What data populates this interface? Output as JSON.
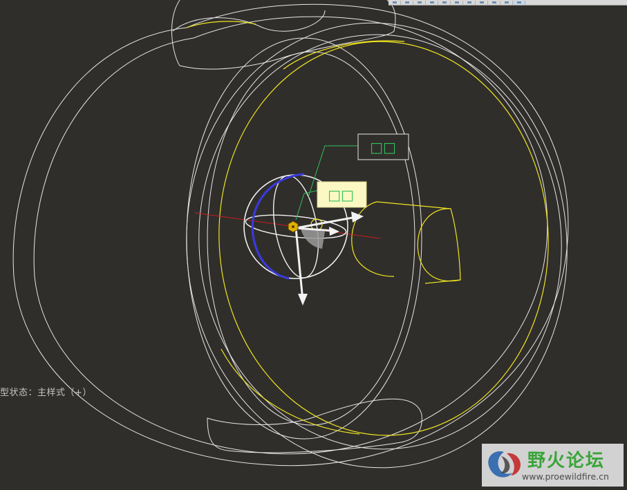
{
  "toolbar": {
    "buttons": [
      {
        "name": "view-orient-icon"
      },
      {
        "name": "arrow-icon"
      },
      {
        "name": "arrow-icon"
      },
      {
        "name": "view-cube-icon"
      },
      {
        "name": "refit-icon"
      },
      {
        "name": "zoom-icon"
      },
      {
        "name": "display-style-icon"
      },
      {
        "name": "saved-views-icon"
      },
      {
        "name": "datum-display-icon"
      },
      {
        "name": "spin-center-icon"
      },
      {
        "name": "settings-icon"
      }
    ]
  },
  "viewport": {
    "dragger_label": "□□",
    "offset_label": "□□",
    "status_text": "型状态：主样式（+）"
  },
  "watermark": {
    "title": "野火论坛",
    "url": "www.proewildfire.cn"
  },
  "colors": {
    "background": "#302e2b",
    "wireframe": "#e8e8e8",
    "highlight": "#f0e620",
    "dragger_blue": "#3a3ae0",
    "axis_red": "#c81e1e",
    "leader_green": "#2fc25b",
    "label_fill": "#fbf8c4"
  }
}
